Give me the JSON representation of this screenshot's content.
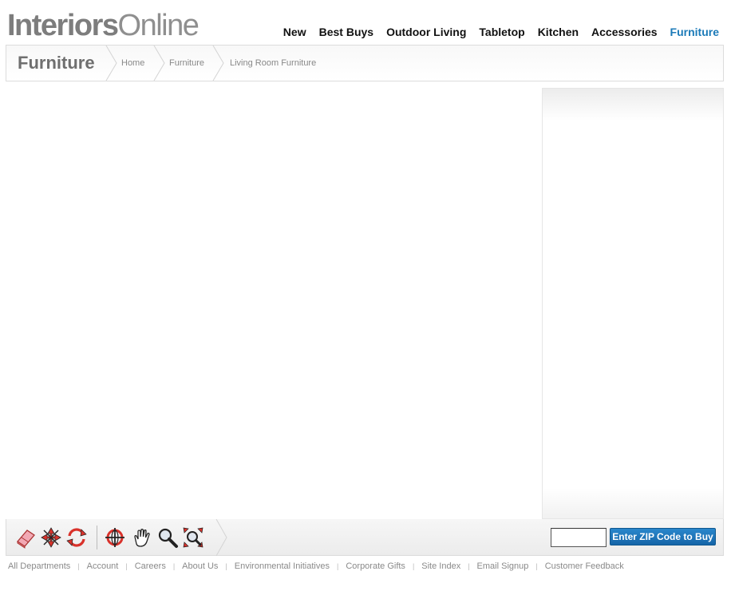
{
  "logo": {
    "part1": "Interiors",
    "part2": "Online"
  },
  "topnav": [
    {
      "label": "New"
    },
    {
      "label": "Best Buys"
    },
    {
      "label": "Outdoor Living"
    },
    {
      "label": "Tabletop"
    },
    {
      "label": "Kitchen"
    },
    {
      "label": "Accessories"
    },
    {
      "label": "Furniture",
      "active": true
    }
  ],
  "breadcrumb": {
    "title": "Furniture",
    "items": [
      "Home",
      "Furniture",
      "Living Room Furniture"
    ]
  },
  "toolbar": {
    "tools": [
      "eraser-icon",
      "pan-arrows-icon",
      "orbit-icon",
      "look-around-icon",
      "hand-icon",
      "zoom-icon",
      "zoom-extents-icon"
    ],
    "zip_value": "",
    "zip_button": "Enter ZIP Code to Buy"
  },
  "footer": [
    "All Departments",
    "Account",
    "Careers",
    "About Us",
    "Environmental Initiatives",
    "Corporate Gifts",
    "Site Index",
    "Email Signup",
    "Customer Feedback"
  ],
  "colors": {
    "accent": "#1b7ab8",
    "button": "#1a6fb5",
    "tool_red": "#d9322b"
  }
}
